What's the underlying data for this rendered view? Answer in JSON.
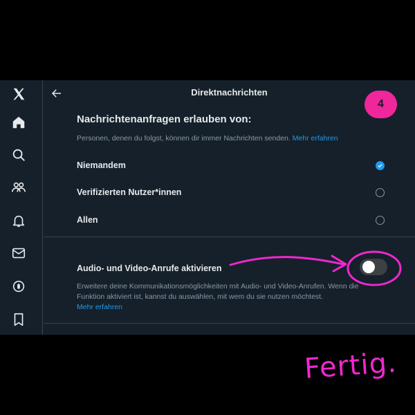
{
  "header": {
    "title": "Direktnachrichten"
  },
  "nav": {
    "items": [
      {
        "icon": "home-icon"
      },
      {
        "icon": "search-icon"
      },
      {
        "icon": "communities-icon"
      },
      {
        "icon": "notifications-bell-icon"
      },
      {
        "icon": "messages-envelope-icon"
      },
      {
        "icon": "spaces-icon"
      },
      {
        "icon": "bookmark-icon"
      }
    ]
  },
  "message_requests": {
    "title": "Nachrichtenanfragen erlauben von:",
    "description": "Personen, denen du folgst, können dir immer Nachrichten senden.",
    "learn_more": "Mehr erfahren",
    "options": [
      {
        "label": "Niemandem",
        "selected": true
      },
      {
        "label": "Verifizierten Nutzer*innen",
        "selected": false
      },
      {
        "label": "Allen",
        "selected": false
      }
    ]
  },
  "calls": {
    "title": "Audio- und Video-Anrufe aktivieren",
    "description": "Erweitere deine Kommunikationsmöglichkeiten mit Audio- und Video-Anrufen. Wenn die Funktion aktiviert ist, kannst du auswählen, mit wem du sie nutzen möchtest.",
    "learn_more": "Mehr erfahren",
    "enabled": false
  },
  "annotations": {
    "step_number": "4",
    "done_text": "Fertig.",
    "color": "#f027cf"
  },
  "colors": {
    "background": "#15202b",
    "accent": "#1d9bf0",
    "muted_text": "#8b98a5",
    "border": "#38444d"
  }
}
